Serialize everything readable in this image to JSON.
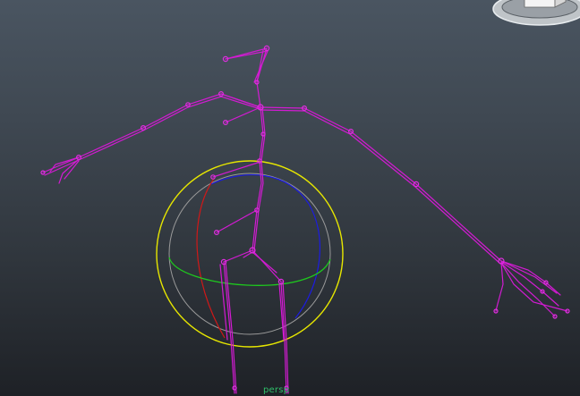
{
  "viewport": {
    "camera_label": "persp",
    "background_top": "#4a5561",
    "background_bottom": "#1e2126"
  },
  "colors": {
    "skeleton": "#d21bd2",
    "joint": "#e02ee0",
    "rotate_outer": "#e6e600",
    "rotate_view": "#9a9a9a",
    "rotate_x": "#d01818",
    "rotate_y": "#1ec81e",
    "rotate_z": "#1c1ce0",
    "camera_label": "#2fbf6a"
  },
  "icons": {
    "view_cube": "view-cube-icon",
    "rotate_manipulator": "rotate-manipulator-icon"
  }
}
